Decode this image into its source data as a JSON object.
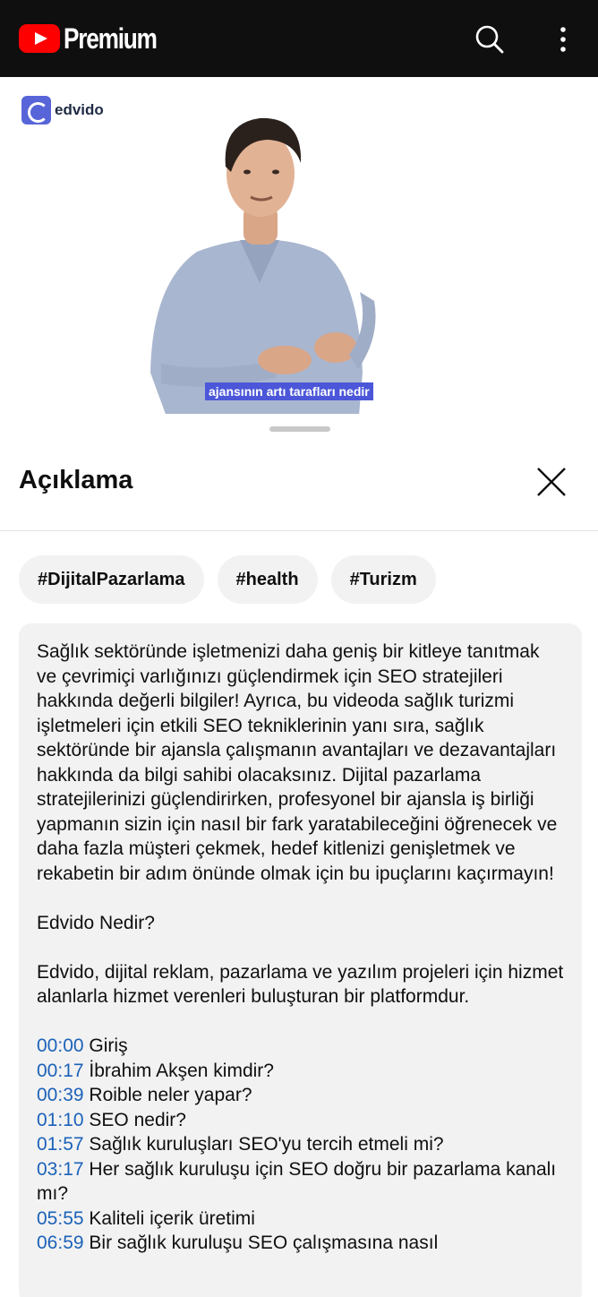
{
  "header": {
    "brand": "Premium",
    "icons": [
      "youtube-logo-icon",
      "search-icon",
      "more-vert-icon"
    ]
  },
  "video": {
    "logo_text": "edvido",
    "caption": "ajansının artı tarafları nedir"
  },
  "sheet": {
    "title": "Açıklama",
    "hashtags": [
      "#DijitalPazarlama",
      "#health",
      "#Turizm"
    ],
    "description": "Sağlık sektöründe işletmenizi daha geniş bir kitleye tanıtmak ve çevrimiçi varlığınızı güçlendirmek için SEO stratejileri hakkında değerli bilgiler! Ayrıca, bu videoda sağlık turizmi işletmeleri için etkili SEO tekniklerinin yanı sıra, sağlık sektöründe bir ajansla çalışmanın avantajları ve dezavantajları hakkında da bilgi sahibi olacaksınız. Dijital pazarlama stratejilerinizi güçlendirirken, profesyonel bir ajansla iş birliği yapmanın sizin için nasıl bir fark yaratabileceğini öğrenecek ve daha fazla müşteri çekmek, hedef kitlenizi genişletmek ve rekabetin bir adım önünde olmak için bu ipuçlarını kaçırmayın!",
    "edvido_heading": "Edvido Nedir?",
    "edvido_text": "Edvido, dijital reklam, pazarlama ve yazılım projeleri için hizmet alanlarla hizmet verenleri buluşturan bir platformdur.",
    "chapters": [
      {
        "time": "00:00",
        "title": "Giriş"
      },
      {
        "time": "00:17",
        "title": "İbrahim Akşen kimdir?"
      },
      {
        "time": "00:39",
        "title": "Roible neler yapar?"
      },
      {
        "time": "01:10",
        "title": "SEO nedir?"
      },
      {
        "time": "01:57",
        "title": "Sağlık kuruluşları SEO'yu tercih etmeli mi?"
      },
      {
        "time": "03:17",
        "title": "Her sağlık kuruluşu için SEO doğru bir pazarlama kanalı mı?"
      },
      {
        "time": "05:55",
        "title": "Kaliteli içerik üretimi"
      },
      {
        "time": "06:59",
        "title": "Bir sağlık kuruluşu SEO çalışmasına nasıl"
      }
    ]
  },
  "colors": {
    "topbar": "#0f0f0f",
    "youtube_red": "#ff0000",
    "timestamp_link": "#1c62b9",
    "chip_bg": "#f2f2f2",
    "caption_bg": "#4b57d8",
    "edvido_brand": "#5865d8"
  }
}
